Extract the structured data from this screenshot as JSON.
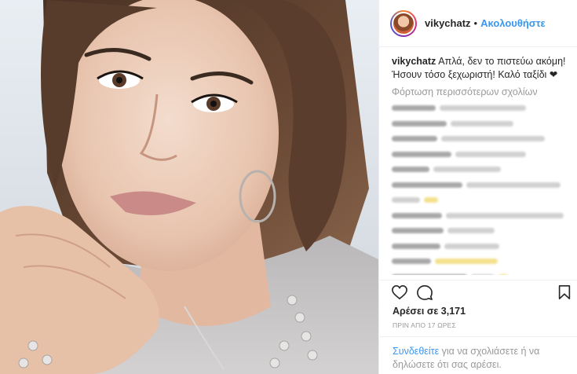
{
  "post": {
    "username": "vikychatz",
    "follow_label": "Ακολουθήστε",
    "separator": "•",
    "caption": "Απλά, δεν το πιστεύω ακόμη! Ήσουν τόσο ξεχωριστή! Καλό ταξίδι ❤",
    "load_more": "Φόρτωση περισσότερων σχολίων",
    "likes": "Αρέσει σε 3,171",
    "time_ago": "ΠΡΙΝ ΑΠΟ 17 ΩΡΕΣ",
    "login_link": "Συνδεθείτε",
    "login_text": " για να σχολιάσετε ή να δηλώσετε ότι σας αρέσει."
  },
  "icons": {
    "like": "heart-icon",
    "comment": "comment-icon",
    "save": "bookmark-icon"
  },
  "colors": {
    "link_blue": "#3897f0",
    "text": "#262626",
    "muted": "#999999"
  }
}
